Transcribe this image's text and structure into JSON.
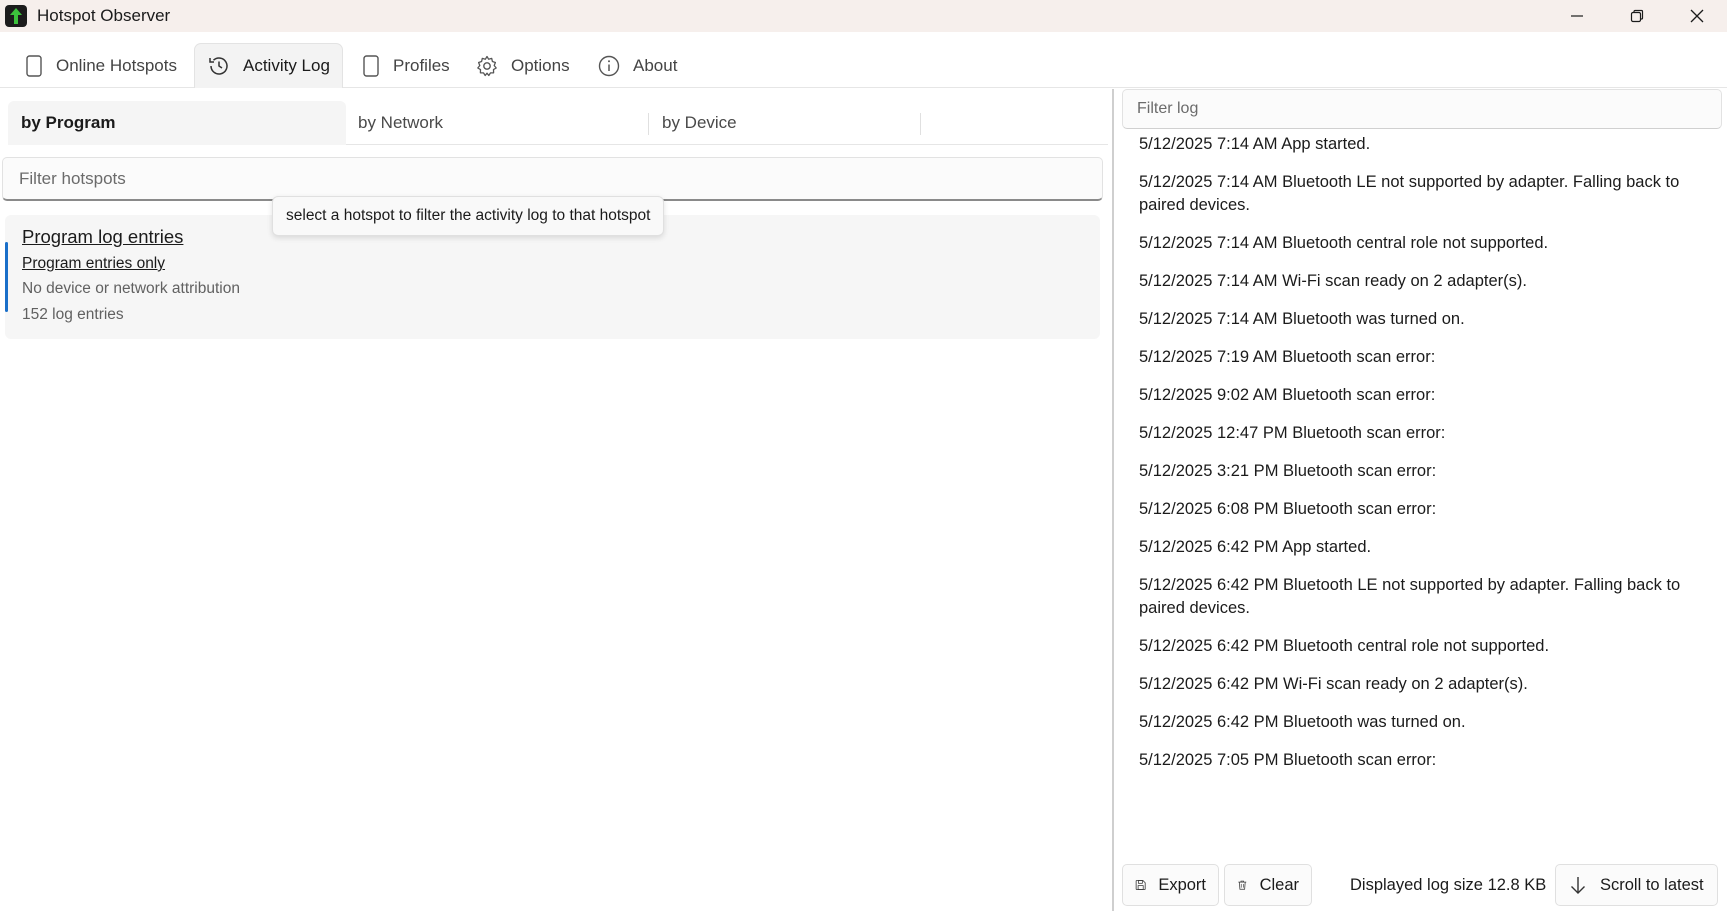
{
  "window": {
    "title": "Hotspot Observer",
    "accent_color": "#1a6fc9",
    "titlebar_color": "#f6efec"
  },
  "tabs": [
    {
      "label": "Online Hotspots",
      "icon": "phone-icon",
      "active": false
    },
    {
      "label": "Activity Log",
      "icon": "history-icon",
      "active": true
    },
    {
      "label": "Profiles",
      "icon": "phone-icon",
      "active": false
    },
    {
      "label": "Options",
      "icon": "gear-icon",
      "active": false
    },
    {
      "label": "About",
      "icon": "info-icon",
      "active": false
    }
  ],
  "left": {
    "subtabs": [
      {
        "label": "by Program",
        "active": true
      },
      {
        "label": "by Network",
        "active": false
      },
      {
        "label": "by Device",
        "active": false
      }
    ],
    "filter_placeholder": "Filter hotspots",
    "tooltip": "select a hotspot to filter the activity log to that hotspot",
    "card": {
      "title": "Program log entries",
      "subtitle": "Program entries only",
      "line1": "No device or network attribution",
      "line2": "152 log entries"
    }
  },
  "right": {
    "filter_placeholder": "Filter log",
    "log": [
      "5/12/2025 7:14 AM App started.",
      "5/12/2025 7:14 AM Bluetooth LE not supported by adapter. Falling back to paired devices.",
      "5/12/2025 7:14 AM Bluetooth central role not supported.",
      "5/12/2025 7:14 AM Wi-Fi scan ready on 2 adapter(s).",
      "5/12/2025 7:14 AM Bluetooth was turned on.",
      "5/12/2025 7:19 AM Bluetooth scan error:",
      "5/12/2025 9:02 AM Bluetooth scan error:",
      "5/12/2025 12:47 PM Bluetooth scan error:",
      "5/12/2025 3:21 PM Bluetooth scan error:",
      "5/12/2025 6:08 PM Bluetooth scan error:",
      "5/12/2025 6:42 PM App started.",
      "5/12/2025 6:42 PM Bluetooth LE not supported by adapter. Falling back to paired devices.",
      "5/12/2025 6:42 PM Bluetooth central role not supported.",
      "5/12/2025 6:42 PM Wi-Fi scan ready on 2 adapter(s).",
      "5/12/2025 6:42 PM Bluetooth was turned on.",
      "5/12/2025 7:05 PM Bluetooth scan error:"
    ],
    "export_label": "Export",
    "clear_label": "Clear",
    "size_label": "Displayed log size 12.8 KB",
    "scroll_label": "Scroll to latest"
  }
}
